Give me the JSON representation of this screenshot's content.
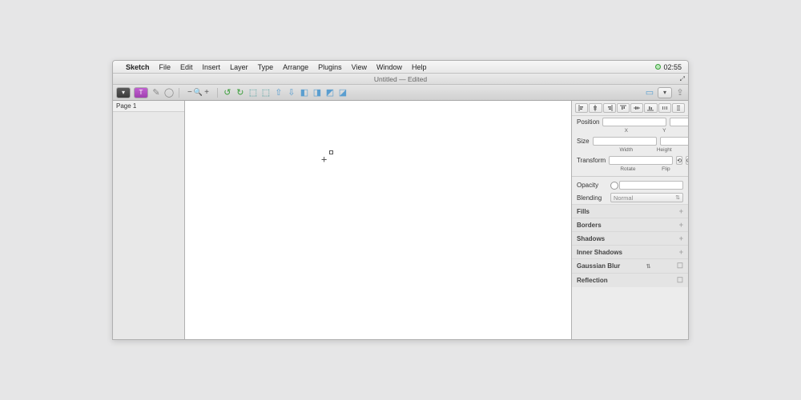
{
  "menubar": {
    "app_name": "Sketch",
    "items": [
      "File",
      "Edit",
      "Insert",
      "Layer",
      "Type",
      "Arrange",
      "Plugins",
      "View",
      "Window",
      "Help"
    ],
    "clock": "02:55"
  },
  "titlebar": {
    "title": "Untitled — Edited"
  },
  "toolbar": {
    "text_tool_label": "T",
    "zoom_out": "−",
    "zoom_in": "+",
    "zoom_icon": "🔍"
  },
  "sidebar": {
    "page_label": "Page 1"
  },
  "inspector": {
    "position_label": "Position",
    "x_label": "X",
    "y_label": "Y",
    "size_label": "Size",
    "width_label": "Width",
    "height_label": "Height",
    "transform_label": "Transform",
    "rotate_label": "Rotate",
    "flip_label": "Flip",
    "flip_h_icon": "⟲",
    "flip_v_icon": "⟳",
    "opacity_label": "Opacity",
    "blending_label": "Blending",
    "blending_value": "Normal",
    "sections": {
      "fills": "Fills",
      "borders": "Borders",
      "shadows": "Shadows",
      "inner_shadows": "Inner Shadows",
      "gaussian_blur": "Gaussian Blur",
      "reflection": "Reflection"
    }
  }
}
